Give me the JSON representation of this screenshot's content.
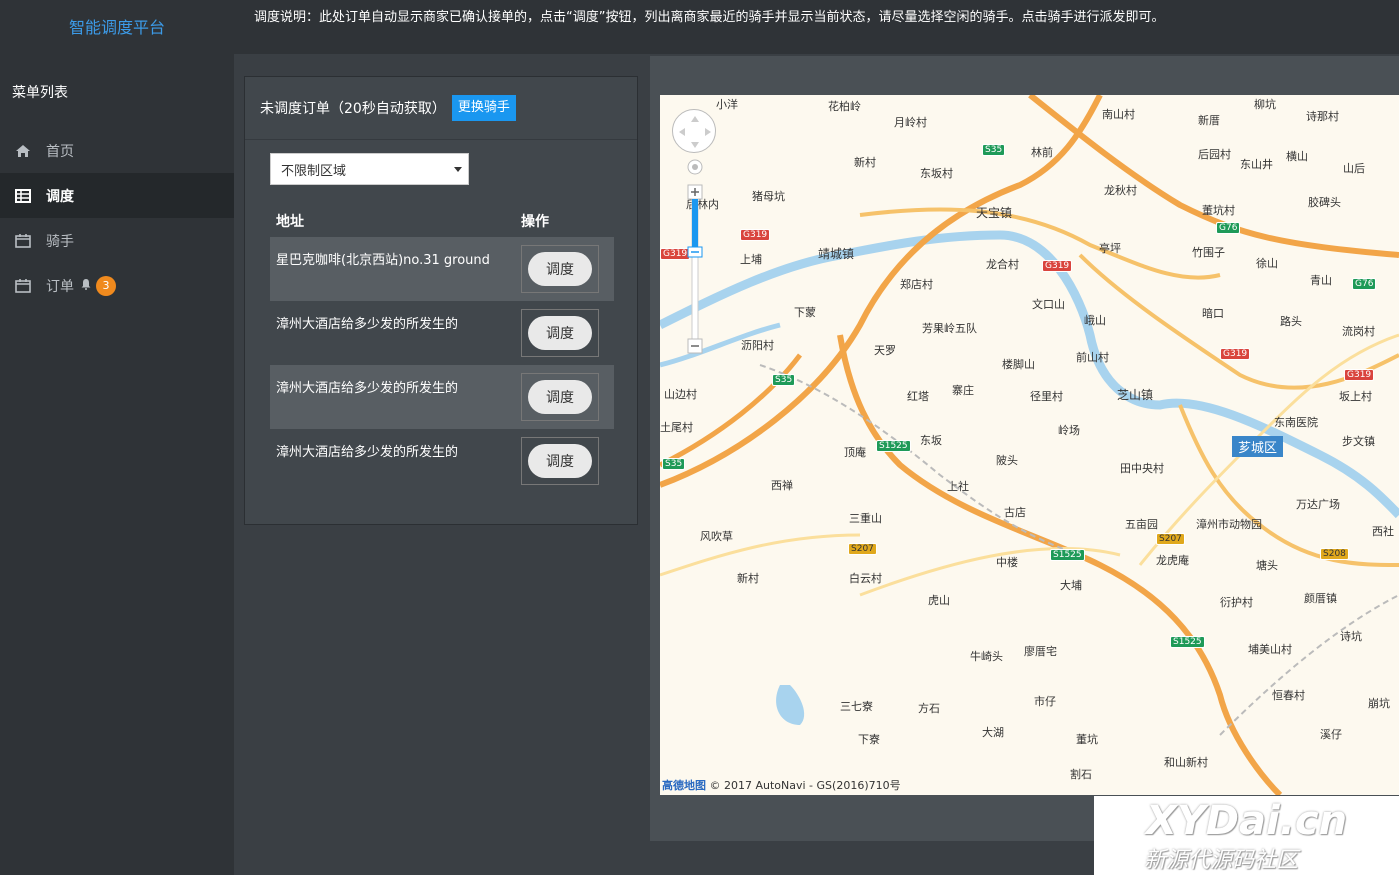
{
  "brand": "智能调度平台",
  "menu_title": "菜单列表",
  "menu": [
    {
      "label": "首页",
      "icon": "home-icon"
    },
    {
      "label": "调度",
      "icon": "table-icon",
      "active": true
    },
    {
      "label": "骑手",
      "icon": "calendar-icon"
    },
    {
      "label": "订单",
      "icon": "calendar-icon",
      "badge": "3"
    }
  ],
  "notice": "调度说明：此处订单自动显示商家已确认接单的，点击“调度”按钮，列出离商家最近的骑手并显示当前状态，请尽量选择空闲的骑手。点击骑手进行派发即可。",
  "panel": {
    "title": "未调度订单（20秒自动获取）",
    "switch_label": "更换骑手",
    "region": "不限制区域",
    "col_address": "地址",
    "col_action": "操作",
    "rows": [
      {
        "address": "星巴克咖啡(北京西站)no.31 ground",
        "action": "调度"
      },
      {
        "address": "漳州大酒店给多少发的所发生的",
        "action": "调度"
      },
      {
        "address": "漳州大酒店给多少发的所发生的",
        "action": "调度"
      },
      {
        "address": "漳州大酒店给多少发的所发生的",
        "action": "调度"
      }
    ]
  },
  "map": {
    "district": "芗城区",
    "attribution_logo": "高德地图",
    "attribution": "© 2017 AutoNavi - GS(2016)710号",
    "labels": [
      "小洋",
      "花柏岭",
      "月岭村",
      "南山村",
      "新厝",
      "后园村",
      "东山井",
      "横山",
      "山后",
      "诗那村",
      "柳坑",
      "林前",
      "新村",
      "东坂村",
      "天宝镇",
      "龙秋村",
      "董坑村",
      "胶碑头",
      "猪母坑",
      "后林内",
      "上埔",
      "靖城镇",
      "龙合村",
      "亭坪",
      "竹围子",
      "徐山",
      "青山",
      "郑店村",
      "文口山",
      "下蒙",
      "暗口",
      "路头",
      "芳果岭五队",
      "峨山",
      "流岗村",
      "沥阳村",
      "天罗",
      "楼脚山",
      "前山村",
      "红塔",
      "寨庄",
      "径里村",
      "芝山镇",
      "东南医院",
      "坂上村",
      "山边村",
      "岭场",
      "步文镇",
      "顶庵",
      "东坂",
      "田中央村",
      "土尾村",
      "陂头",
      "上社",
      "西禅",
      "古店",
      "五亩园",
      "漳州市动物园",
      "万达广场",
      "西社",
      "三重山",
      "风吹草",
      "中楼",
      "龙虎庵",
      "塘头",
      "颜厝镇",
      "新村",
      "白云村",
      "虎山",
      "大埔",
      "衍护村",
      "诗坑",
      "牛崎头",
      "廖厝宅",
      "埔美山村",
      "恒春村",
      "三七寮",
      "方石",
      "市仔",
      "崩坑",
      "下寮",
      "大湖",
      "董坑",
      "和山新村",
      "溪仔",
      "割石"
    ],
    "shields": [
      "S35",
      "G319",
      "G319",
      "G319",
      "G319",
      "G319",
      "G76",
      "G76",
      "S35",
      "S35",
      "S1525",
      "S1525",
      "S1525",
      "S207",
      "S207",
      "S208"
    ]
  },
  "watermark": {
    "main": "XYDai.cn",
    "sub": "新源代源码社区"
  },
  "colors": {
    "sidebar": "#2f3337",
    "content": "#3a3f44",
    "accent": "#1a97f0",
    "brand": "#3c9be8",
    "badge": "#f08a1e"
  }
}
